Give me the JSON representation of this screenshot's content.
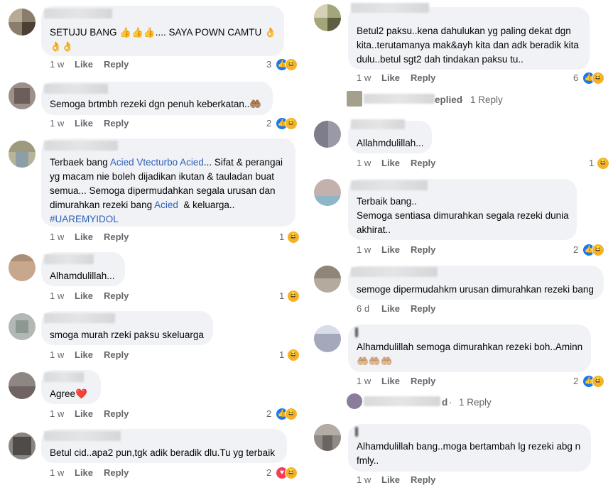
{
  "actions": {
    "like": "Like",
    "reply": "Reply"
  },
  "left": [
    {
      "text": "SETUJU BANG 👍👍👍.... SAYA POWN CAMTU 👌\n👌👌",
      "time": "1 w",
      "count": "3",
      "reactions": [
        "like-icon",
        "haha-icon"
      ]
    },
    {
      "text": "Semoga brtmbh rezeki dgn penuh keberkatan..🤲🏽",
      "time": "1 w",
      "count": "2",
      "reactions": [
        "like-icon",
        "haha-icon"
      ]
    },
    {
      "text_parts": [
        "Terbaek bang ",
        "Acied Vtecturbo Acied",
        "... Sifat & perangai\nyg macam nie boleh dijadikan ikutan & tauladan buat\nsemua... Semoga dipermudahkan segala urusan dan\ndimurahkan rezeki bang ",
        "Acied",
        "  & keluarga..\n",
        "#UAREMYIDOL"
      ],
      "time": "1 w",
      "count": "1",
      "reactions": [
        "haha-icon"
      ]
    },
    {
      "text": "Alhamdulillah...",
      "time": "1 w",
      "count": "1",
      "reactions": [
        "haha-icon"
      ]
    },
    {
      "text": "smoga murah rzeki paksu skeluarga",
      "time": "1 w",
      "count": "1",
      "reactions": [
        "haha-icon"
      ]
    },
    {
      "text": "Agree❤️",
      "time": "1 w",
      "count": "2",
      "reactions": [
        "like-icon",
        "haha-icon"
      ]
    },
    {
      "text": "Betul cid..apa2 pun,tgk adik beradik dlu.Tu yg terbaik",
      "time": "1 w",
      "count": "2",
      "reactions": [
        "love-icon",
        "haha-icon"
      ]
    }
  ],
  "right": [
    {
      "text": "Betul2 paksu..kena dahulukan yg paling dekat dgn\nkita..terutamanya mak&ayh kita dan adk beradik kita\ndulu..betul sgt2 dah tindakan paksu tu..",
      "time": "1 w",
      "count": "6",
      "reactions": [
        "like-icon",
        "haha-icon"
      ]
    },
    {
      "replies_partial": "eplied",
      "replies_sep": " · ",
      "replies_count": "1 Reply"
    },
    {
      "text": "Allahmdulillah...",
      "time": "1 w",
      "count": "1",
      "reactions": [
        "haha-icon"
      ]
    },
    {
      "text": "Terbaik bang..\nSemoga sentiasa dimurahkan segala rezeki dunia\nakhirat..",
      "time": "1 w",
      "count": "2",
      "reactions": [
        "like-icon",
        "haha-icon"
      ]
    },
    {
      "text": "semoge dipermudahkm urusan dimurahkan rezeki bang",
      "time": "6 d"
    },
    {
      "text": "Alhamdulillah semoga dimurahkan rezeki boh..Aminn\n🤲🏼🤲🏼🤲🏼",
      "time": "1 w",
      "count": "2",
      "reactions": [
        "like-icon",
        "haha-icon"
      ]
    },
    {
      "replies_partial": "d",
      "replies_sep": " · ",
      "replies_count": "1 Reply"
    },
    {
      "text": "Alhamdulillah bang..moga bertambah lg rezeki abg n\nfmly..",
      "time": "1 w"
    }
  ]
}
